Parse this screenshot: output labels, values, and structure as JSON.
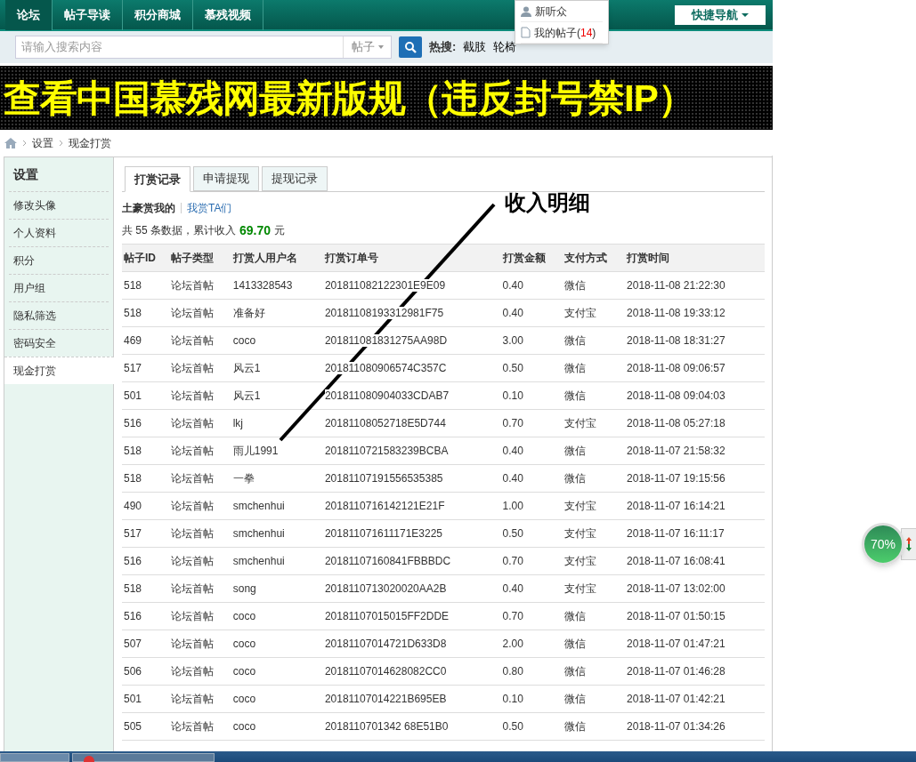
{
  "nav": {
    "items": [
      {
        "label": "论坛",
        "selected": true
      },
      {
        "label": "帖子导读",
        "selected": false
      },
      {
        "label": "积分商城",
        "selected": false
      },
      {
        "label": "慕残视频",
        "selected": false
      }
    ],
    "quick_nav": "快捷导航"
  },
  "user_menu": {
    "items": [
      {
        "label": "新听众",
        "kind": "user"
      },
      {
        "label": "我的帖子",
        "paren_open": "(",
        "count": "14",
        "paren_close": ")",
        "kind": "doc"
      }
    ]
  },
  "search": {
    "placeholder": "请输入搜索内容",
    "scope": "帖子",
    "hot_label": "热搜:",
    "hot": [
      "截肢",
      "轮椅"
    ]
  },
  "banner": "查看中国慕残网最新版规（违反封号禁IP）",
  "breadcrumb": [
    "设置",
    "现金打赏"
  ],
  "sidebar": {
    "title": "设置",
    "items": [
      {
        "label": "修改头像",
        "selected": false
      },
      {
        "label": "个人资料",
        "selected": false
      },
      {
        "label": "积分",
        "selected": false
      },
      {
        "label": "用户组",
        "selected": false
      },
      {
        "label": "隐私筛选",
        "selected": false
      },
      {
        "label": "密码安全",
        "selected": false
      },
      {
        "label": "现金打赏",
        "selected": true
      }
    ]
  },
  "tabs": [
    {
      "label": "打赏记录",
      "selected": true
    },
    {
      "label": "申请提现",
      "selected": false
    },
    {
      "label": "提现记录",
      "selected": false
    }
  ],
  "subtabs": [
    {
      "label": "土豪赏我的",
      "selected": true
    },
    {
      "label": "我赏TA们",
      "selected": false
    }
  ],
  "summary": {
    "prefix": "共 55 条数据，累计收入",
    "total": "69.70",
    "suffix": "元"
  },
  "annotation": "收入明细",
  "table": {
    "columns": [
      "帖子ID",
      "帖子类型",
      "打赏人用户名",
      "打赏订单号",
      "打赏金额",
      "支付方式",
      "打赏时间"
    ],
    "rows": [
      [
        "518",
        "论坛首帖",
        "1413328543",
        "201811082122301E9E09",
        "0.40",
        "微信",
        "2018-11-08 21:22:30"
      ],
      [
        "518",
        "论坛首帖",
        "准备好",
        "20181108193312981F75",
        "0.40",
        "支付宝",
        "2018-11-08 19:33:12"
      ],
      [
        "469",
        "论坛首帖",
        "coco",
        "201811081831275AA98D",
        "3.00",
        "微信",
        "2018-11-08 18:31:27"
      ],
      [
        "517",
        "论坛首帖",
        "风云1",
        "201811080906574C357C",
        "0.50",
        "微信",
        "2018-11-08 09:06:57"
      ],
      [
        "501",
        "论坛首帖",
        "风云1",
        "201811080904033CDAB7",
        "0.10",
        "微信",
        "2018-11-08 09:04:03"
      ],
      [
        "516",
        "论坛首帖",
        "lkj",
        "20181108052718E5D744",
        "0.70",
        "支付宝",
        "2018-11-08 05:27:18"
      ],
      [
        "518",
        "论坛首帖",
        "雨儿1991",
        "2018110721583239BCBA",
        "0.40",
        "微信",
        "2018-11-07 21:58:32"
      ],
      [
        "518",
        "论坛首帖",
        "一拳",
        "20181107191556535385",
        "0.40",
        "微信",
        "2018-11-07 19:15:56"
      ],
      [
        "490",
        "论坛首帖",
        "smchenhui",
        "2018110716142121E21F",
        "1.00",
        "支付宝",
        "2018-11-07 16:14:21"
      ],
      [
        "517",
        "论坛首帖",
        "smchenhui",
        "201811071611171E3225",
        "0.50",
        "支付宝",
        "2018-11-07 16:11:17"
      ],
      [
        "516",
        "论坛首帖",
        "smchenhui",
        "20181107160841FBBBDC",
        "0.70",
        "支付宝",
        "2018-11-07 16:08:41"
      ],
      [
        "518",
        "论坛首帖",
        "song",
        "2018110713020020AA2B",
        "0.40",
        "支付宝",
        "2018-11-07 13:02:00"
      ],
      [
        "516",
        "论坛首帖",
        "coco",
        "20181107015015FF2DDE",
        "0.70",
        "微信",
        "2018-11-07 01:50:15"
      ],
      [
        "507",
        "论坛首帖",
        "coco",
        "20181107014721D633D8",
        "2.00",
        "微信",
        "2018-11-07 01:47:21"
      ],
      [
        "506",
        "论坛首帖",
        "coco",
        "20181107014628082CC0",
        "0.80",
        "微信",
        "2018-11-07 01:46:28"
      ],
      [
        "501",
        "论坛首帖",
        "coco",
        "20181107014221B695EB",
        "0.10",
        "微信",
        "2018-11-07 01:42:21"
      ],
      [
        "505",
        "论坛首帖",
        "coco",
        "2018110701342 68E51B0",
        "0.50",
        "微信",
        "2018-11-07 01:34:26"
      ]
    ]
  },
  "widget": {
    "percent": "70%"
  }
}
